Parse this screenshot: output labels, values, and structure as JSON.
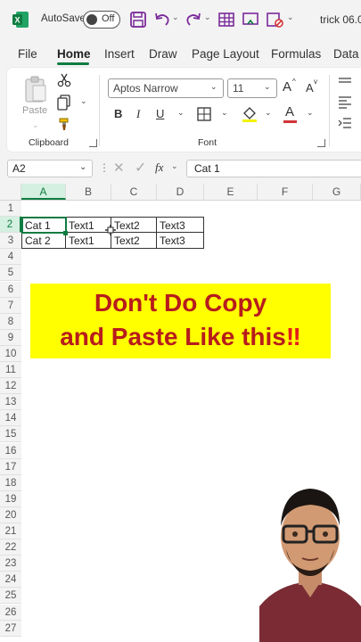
{
  "titlebar": {
    "autosave_label": "AutoSave",
    "autosave_state": "Off",
    "file_title": "trick 06.0"
  },
  "tabs": [
    "File",
    "Home",
    "Insert",
    "Draw",
    "Page Layout",
    "Formulas",
    "Data"
  ],
  "ribbon": {
    "paste_label": "Paste",
    "clipboard_label": "Clipboard",
    "font_name": "Aptos Narrow",
    "font_size": "11",
    "font_group_label": "Font",
    "bold": "B",
    "italic": "I",
    "underline": "U",
    "grow_font": "A",
    "shrink_font": "A",
    "font_color": "A"
  },
  "formula_bar": {
    "name_box": "A2",
    "fx": "fx",
    "content": "Cat 1"
  },
  "grid": {
    "columns": [
      "A",
      "B",
      "C",
      "D",
      "E",
      "F",
      "G"
    ],
    "rows": [
      "1",
      "2",
      "3",
      "4",
      "5",
      "6",
      "7",
      "8",
      "9",
      "10",
      "11",
      "12",
      "13",
      "14",
      "15",
      "16",
      "17",
      "18",
      "19",
      "20",
      "21",
      "22",
      "23",
      "24",
      "25",
      "26",
      "27"
    ],
    "cells": [
      [
        "Cat 1",
        "Text1",
        "Text2",
        "Text3"
      ],
      [
        "Cat 2",
        "Text1",
        "Text2",
        "Text3"
      ]
    ]
  },
  "banner": {
    "line1": "Don't Do Copy",
    "line2": "and Paste Like this",
    "emphasis": "‼"
  },
  "colors": {
    "excel_green": "#107c41",
    "banner_bg": "#ffff00",
    "banner_text": "#b71c1c"
  }
}
